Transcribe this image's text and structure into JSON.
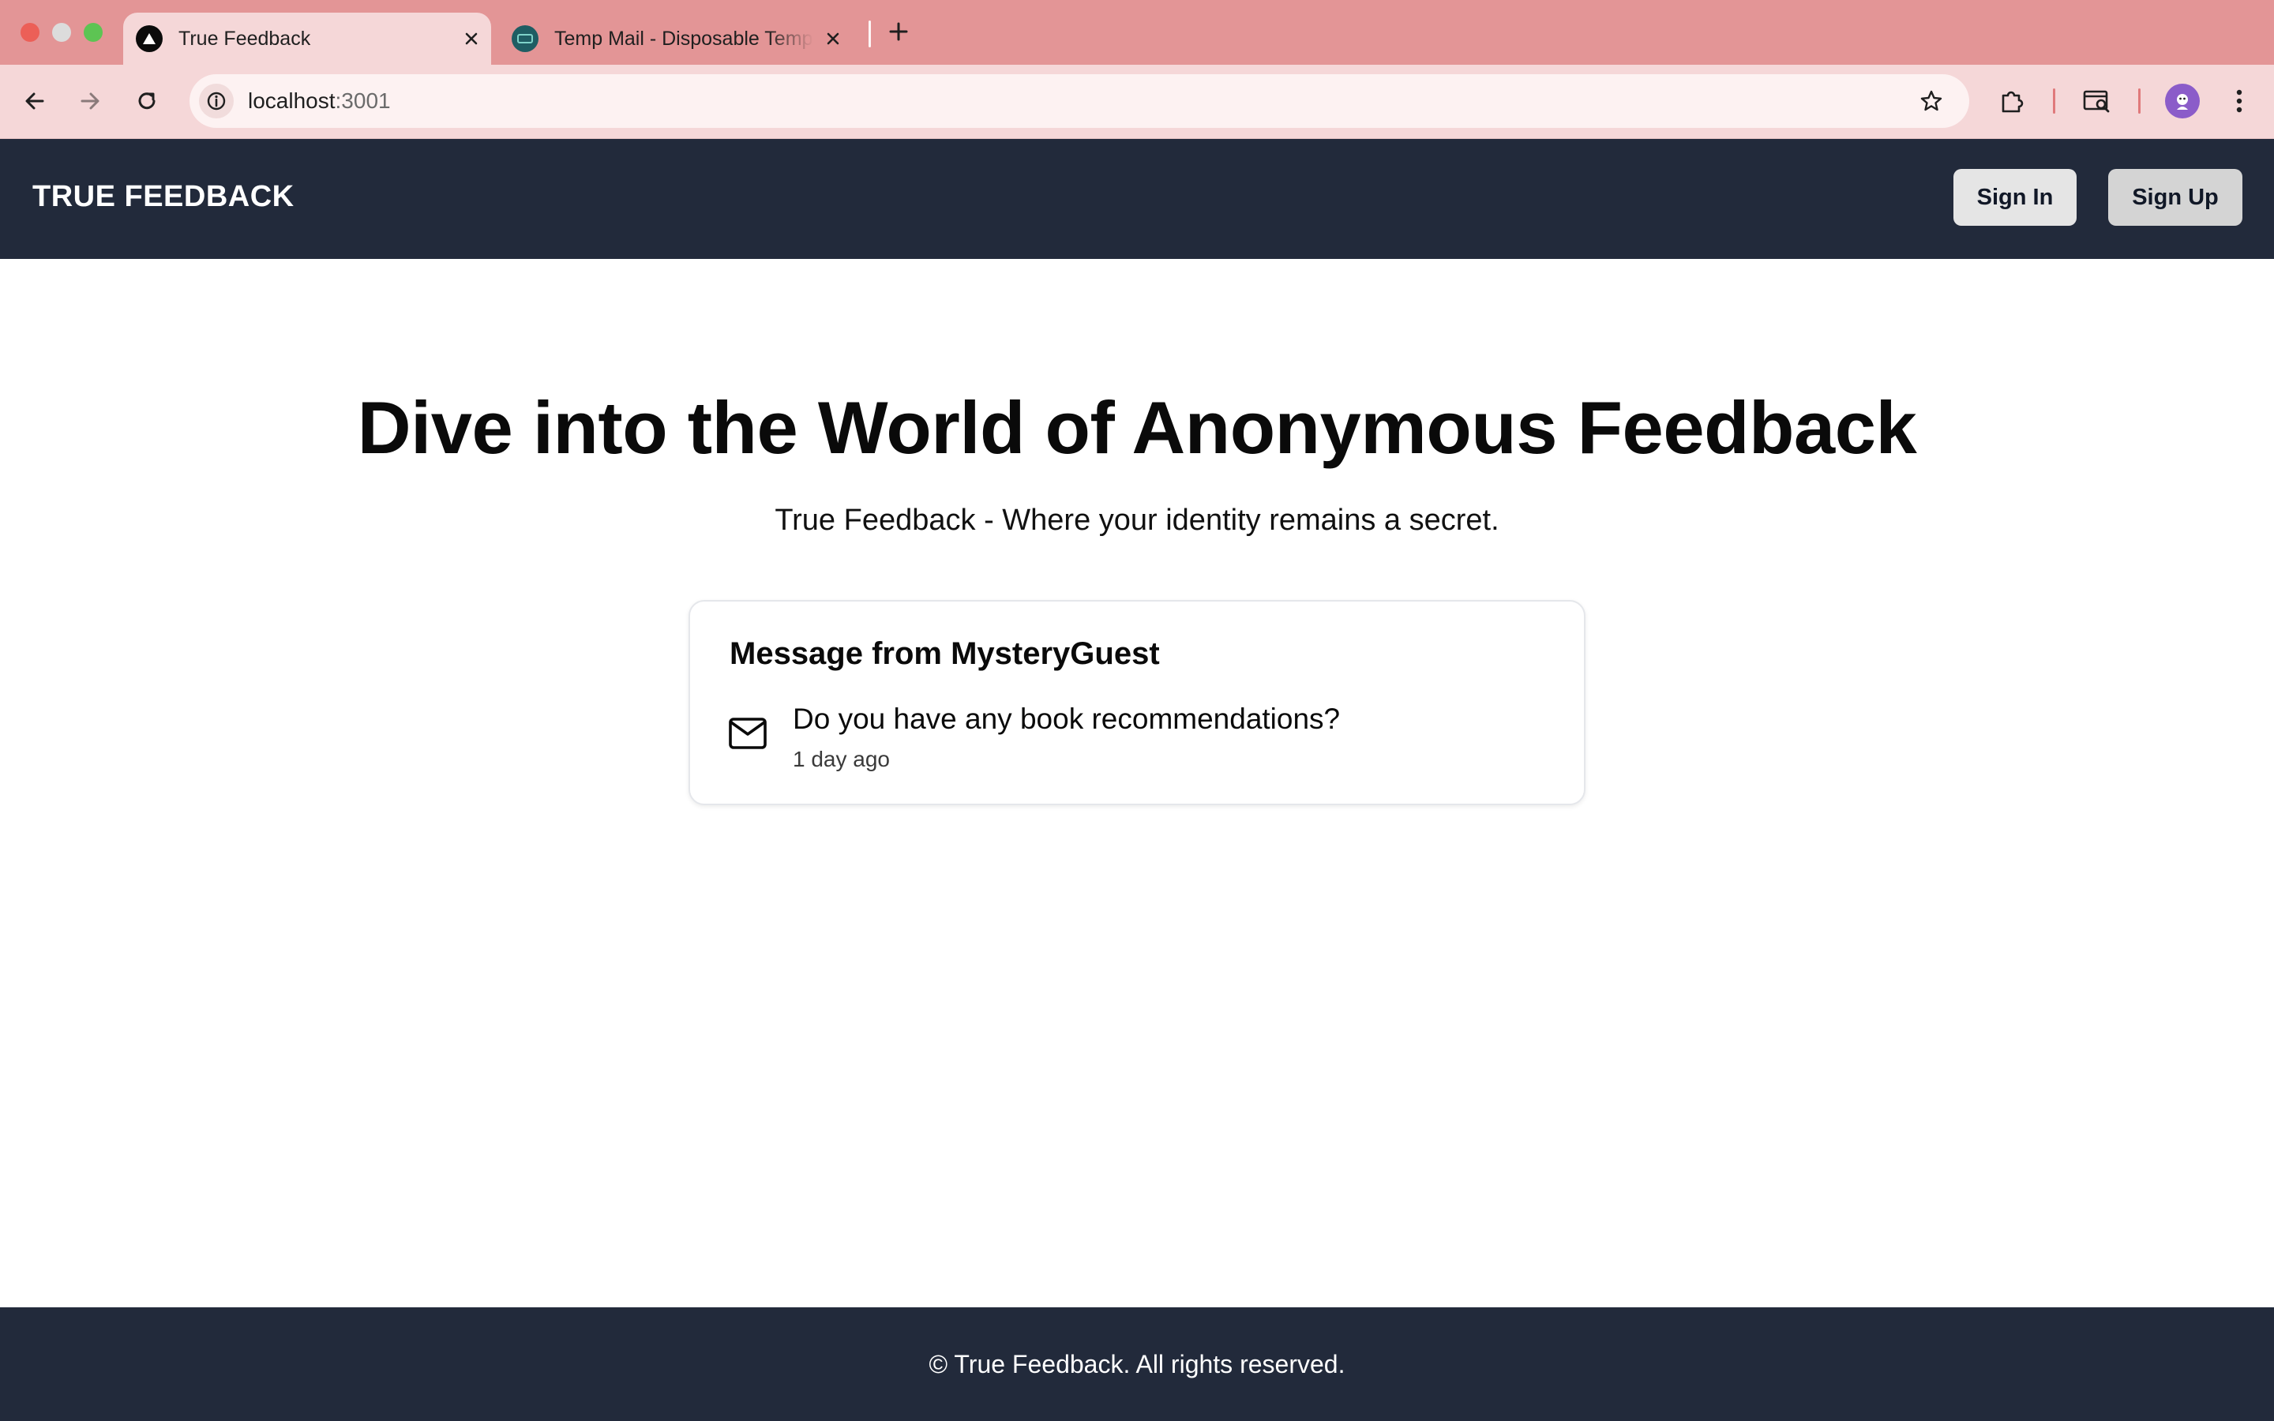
{
  "browser": {
    "tabs": [
      {
        "title": "True Feedback",
        "active": true,
        "favicon": "triangle-logo-icon"
      },
      {
        "title": "Temp Mail - Disposable Temporary Email",
        "active": false,
        "favicon": "temp-mail-logo-icon"
      }
    ],
    "url_host": "localhost",
    "url_port": ":3001"
  },
  "navbar": {
    "brand": "TRUE FEEDBACK",
    "sign_in_label": "Sign In",
    "sign_up_label": "Sign Up"
  },
  "hero": {
    "title": "Dive into the World of Anonymous Feedback",
    "subtitle": "True Feedback - Where your identity remains a secret."
  },
  "message_card": {
    "title": "Message from MysteryGuest",
    "content": "Do you have any book recommendations?",
    "received": "1 day ago",
    "icon": "mail-icon"
  },
  "footer": {
    "text": "© True Feedback. All rights reserved."
  },
  "colors": {
    "browser_frame": "#e39596",
    "browser_toolbar": "#f5d7d8",
    "navbar_bg": "#222a3b",
    "footer_bg": "#222a3b"
  }
}
